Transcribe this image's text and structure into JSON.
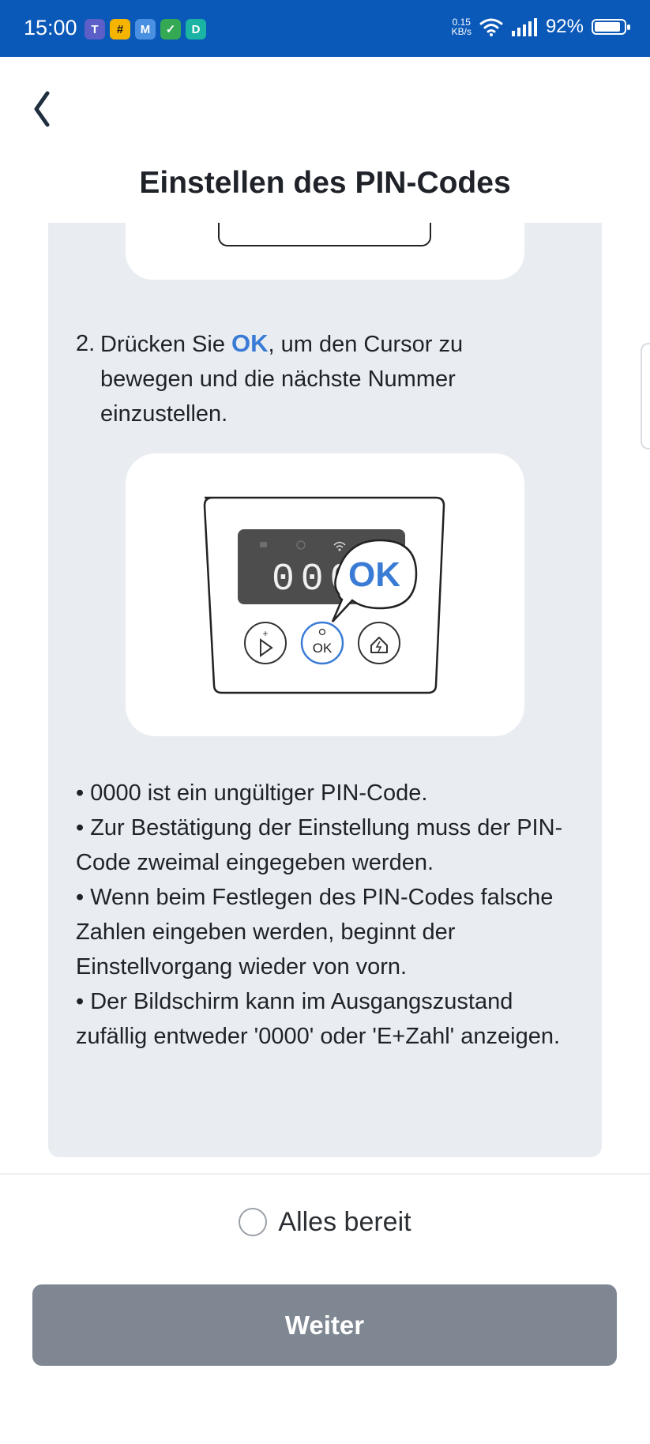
{
  "status_bar": {
    "time": "15:00",
    "network_speed_value": "0.15",
    "network_speed_unit": "KB/s",
    "battery_percent": "92%",
    "battery_level": 0.92,
    "app_icons": [
      "teams-icon",
      "browser-icon",
      "calendar-icon",
      "security-icon",
      "chat-icon"
    ]
  },
  "header": {
    "back_icon": "chevron-left-icon",
    "title": "Einstellen des PIN-Codes"
  },
  "step2": {
    "number": "2.",
    "text_before": "Drücken Sie ",
    "ok_label": "OK",
    "text_after": ", um den Cursor zu bewegen und die nächste Nummer einzustellen."
  },
  "illustration": {
    "display_digits": "000",
    "callout_label": "OK",
    "ok_button_label": "OK"
  },
  "notes": [
    "• 0000 ist ein ungültiger PIN-Code.",
    "• Zur Bestätigung der Einstellung muss der PIN-Code zweimal eingegeben werden.",
    "• Wenn beim Festlegen des PIN-Codes falsche Zahlen eingeben werden, beginnt der Einstellvorgang wieder von vorn.",
    "• Der Bildschirm kann im Ausgangszustand zufällig entweder '0000' oder 'E+Zahl' anzeigen."
  ],
  "footer": {
    "ready_label": "Alles bereit",
    "ready_checked": false,
    "next_label": "Weiter"
  },
  "colors": {
    "status_bar": "#0a58b8",
    "accent": "#3a7bd5",
    "panel": "#e9edf2",
    "button_disabled": "#7f8892"
  }
}
